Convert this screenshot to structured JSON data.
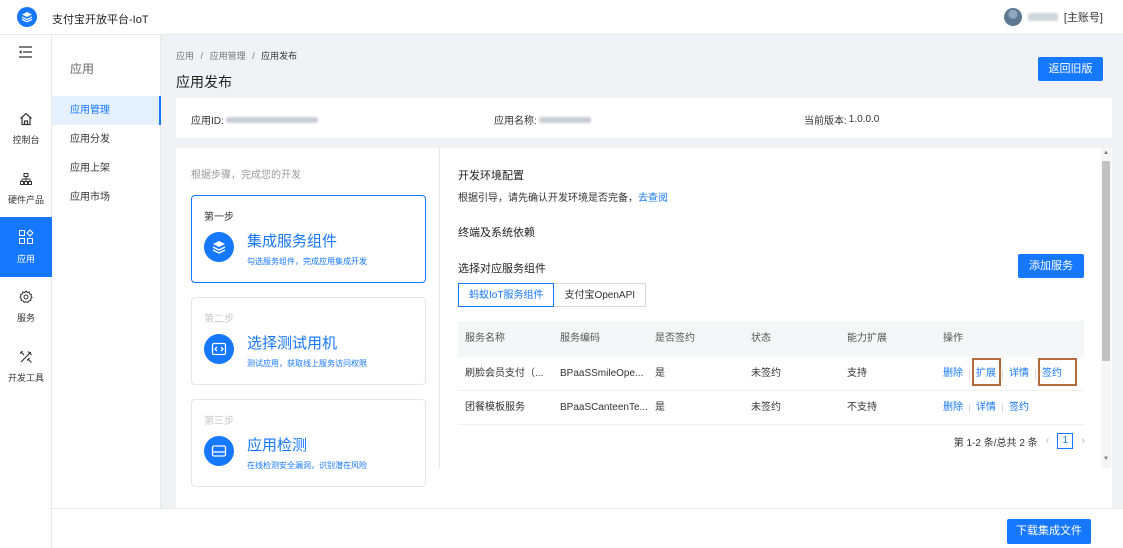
{
  "header": {
    "title": "支付宝开放平台-IoT",
    "user_role": "[主账号]"
  },
  "rail": {
    "items": [
      {
        "label": "控制台",
        "icon": "home-icon"
      },
      {
        "label": "硬件产品",
        "icon": "hardware-icon"
      },
      {
        "label": "应用",
        "icon": "apps-icon",
        "active": true
      },
      {
        "label": "服务",
        "icon": "service-gear-icon"
      },
      {
        "label": "开发工具",
        "icon": "dev-tools-icon"
      }
    ]
  },
  "subnav": {
    "title": "应用",
    "items": [
      {
        "label": "应用管理",
        "active": true
      },
      {
        "label": "应用分发"
      },
      {
        "label": "应用上架"
      },
      {
        "label": "应用市场"
      }
    ]
  },
  "breadcrumb": {
    "items": [
      "应用",
      "应用管理",
      "应用发布"
    ],
    "separator": "/"
  },
  "page": {
    "title": "应用发布",
    "back_button": "返回旧版"
  },
  "app_info": {
    "id_label": "应用ID:",
    "name_label": "应用名称:",
    "version_label": "当前版本:",
    "version_value": "1.0.0.0"
  },
  "steps": {
    "hint": "根据步骤，完成您的开发",
    "items": [
      {
        "no": "第一步",
        "title": "集成服务组件",
        "desc": "勾选服务组件，完成应用集成开发"
      },
      {
        "no": "第二步",
        "title": "选择测试用机",
        "desc": "测试应用，获取线上服务访问权限"
      },
      {
        "no": "第三步",
        "title": "应用检测",
        "desc": "在线检测安全漏洞，识别潜在风险"
      }
    ]
  },
  "dev_env": {
    "title": "开发环境配置",
    "text": "根据引导，请先确认开发环境是否完备，",
    "link": "去查阅"
  },
  "deps": {
    "title": "终端及系统依赖"
  },
  "service_select": {
    "title": "选择对应服务组件",
    "add_button": "添加服务",
    "tabs": [
      "蚂蚁IoT服务组件",
      "支付宝OpenAPI"
    ]
  },
  "table": {
    "headers": [
      "服务名称",
      "服务编码",
      "是否签约",
      "状态",
      "能力扩展",
      "操作"
    ],
    "rows": [
      {
        "name": "刷脸会员支付（...",
        "code": "BPaaSSmileOpe...",
        "signed": "是",
        "status": "未签约",
        "ext": "支持",
        "ops": [
          "删除",
          "扩展",
          "详情",
          "签约"
        ]
      },
      {
        "name": "团餐模板服务",
        "code": "BPaaSCanteenTe...",
        "signed": "是",
        "status": "未签约",
        "ext": "不支持",
        "ops": [
          "删除",
          "详情",
          "签约"
        ]
      }
    ]
  },
  "pager": {
    "summary": "第 1-2 条/总共 2 条",
    "current": "1",
    "prev": "‹",
    "next": "›"
  },
  "footer": {
    "download_button": "下载集成文件"
  },
  "colors": {
    "accent": "#1677ff",
    "highlight": "#b46a3c"
  }
}
